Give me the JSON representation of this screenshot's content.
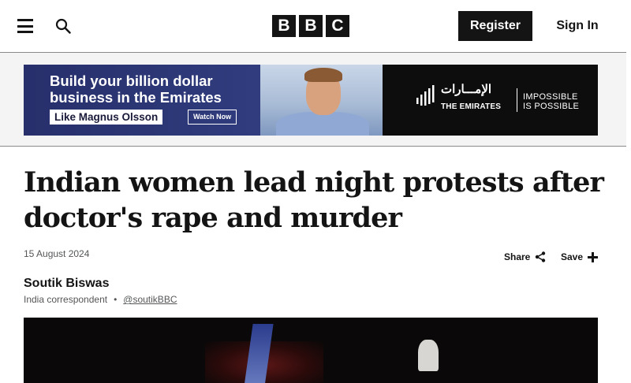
{
  "header": {
    "menu_icon": "hamburger-menu-icon",
    "search_icon": "search-icon",
    "logo_letters": [
      "B",
      "B",
      "C"
    ],
    "register_label": "Register",
    "signin_label": "Sign In"
  },
  "ad": {
    "headline": "Build your billion dollar business in the Emirates",
    "pill": "Like Magnus Olsson",
    "cta": "Watch Now",
    "arabic": "الإمـــارات",
    "brand": "THE EMIRATES",
    "tagline_1": "IMPOSSIBLE",
    "tagline_2": "IS POSSIBLE"
  },
  "article": {
    "headline": "Indian women lead night protests after doctor's rape and murder",
    "date": "15 August 2024",
    "share_label": "Share",
    "save_label": "Save",
    "author": "Soutik Biswas",
    "role": "India correspondent",
    "separator": "•",
    "handle": "@soutikBBC"
  },
  "colors": {
    "text": "#141414",
    "muted": "#545658",
    "ad_blue": "#27306b",
    "ad_black": "#0d0d0d"
  }
}
